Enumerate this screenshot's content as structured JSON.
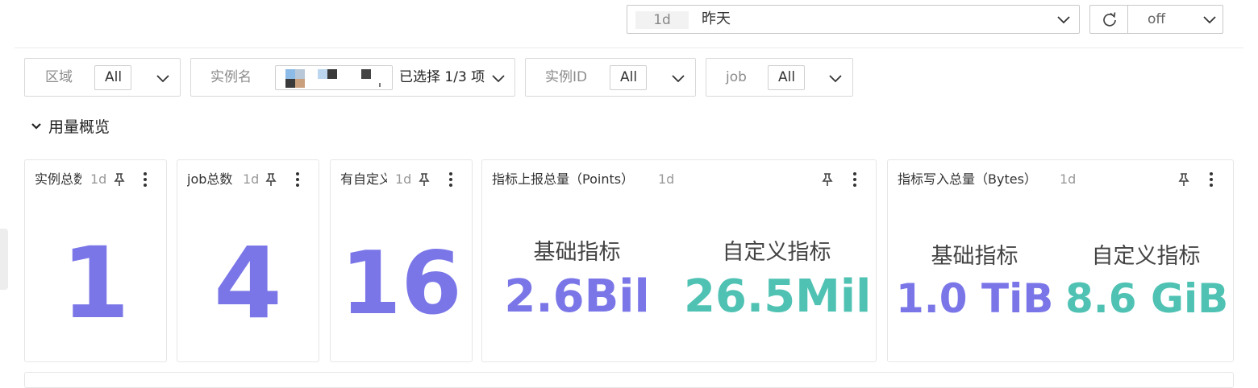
{
  "toolbar": {
    "time_range": {
      "short": "1d",
      "label": "昨天"
    },
    "refresh": {
      "value": "off"
    }
  },
  "filters": [
    {
      "label": "区域",
      "value": "All"
    },
    {
      "label": "实例名",
      "value": "已选择 1/3 项"
    },
    {
      "label": "实例ID",
      "value": "All"
    },
    {
      "label": "job",
      "value": "All"
    }
  ],
  "section": {
    "title": "用量概览"
  },
  "cards": {
    "instance_total": {
      "title": "实例总数",
      "interval": "1d",
      "value": "1"
    },
    "job_total": {
      "title": "job总数",
      "interval": "1d",
      "value": "4"
    },
    "custom_total": {
      "title": "有自定义",
      "interval": "1d",
      "value": "16"
    },
    "points": {
      "title": "指标上报总量（Points）",
      "interval": "1d",
      "basic_label": "基础指标",
      "basic_value": "2.6Bil",
      "custom_label": "自定义指标",
      "custom_value": "26.5Mil"
    },
    "bytes": {
      "title": "指标写入总量（Bytes）",
      "interval": "1d",
      "basic_label": "基础指标",
      "basic_value": "1.0 TiB",
      "custom_label": "自定义指标",
      "custom_value": "8.6 GiB"
    }
  },
  "colors": {
    "primary": "#7a76e8",
    "secondary": "#4fc2b3"
  }
}
